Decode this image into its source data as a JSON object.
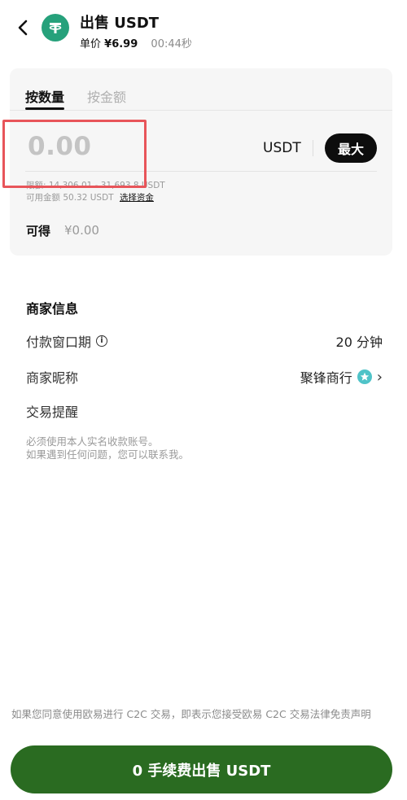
{
  "header": {
    "title": "出售 USDT",
    "price_label": "单价",
    "price_value": "¥6.99",
    "timer": "00:44秒",
    "coin_icon": "tether-icon",
    "back_icon": "chevron-left-icon"
  },
  "form": {
    "tabs": [
      {
        "label": "按数量",
        "active": true
      },
      {
        "label": "按金额",
        "active": false
      }
    ],
    "amount_placeholder": "0.00",
    "currency": "USDT",
    "max_label": "最大",
    "limit_text": "限额: 14,306.01 - 31,693.8   USDT",
    "available_text": "可用金额 50.32 USDT",
    "select_funds_label": "选择资金",
    "receive_label": "可得",
    "receive_value": "¥0.00"
  },
  "merchant": {
    "section_title": "商家信息",
    "payment_window_label": "付款窗口期",
    "payment_window_value": "20 分钟",
    "nickname_label": "商家昵称",
    "nickname_value": "聚锋商行",
    "reminder_label": "交易提醒",
    "reminder_line1": "必须使用本人实名收款账号。",
    "reminder_line2": "如果遇到任何问题，您可以联系我。"
  },
  "footer": {
    "disclaimer": "如果您同意使用欧易进行 C2C 交易，即表示您接受欧易 C2C 交易法律免责声明",
    "sell_button_label": "0 手续费出售 USDT"
  },
  "colors": {
    "accent_green": "#2a6b21",
    "tether_green": "#26a17b",
    "highlight_red": "#e8555a"
  }
}
